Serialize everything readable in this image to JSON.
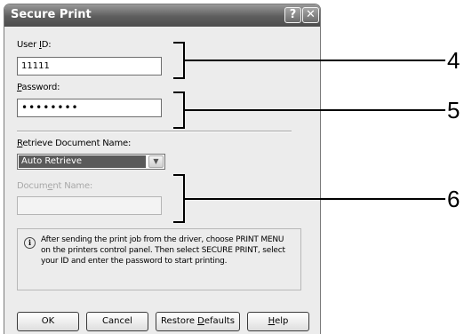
{
  "window": {
    "title": "Secure Print",
    "help_glyph": "?",
    "close_glyph": "✕"
  },
  "user_id": {
    "label_pre": "User ",
    "label_u": "I",
    "label_post": "D:",
    "value": "11111"
  },
  "password": {
    "label_u": "P",
    "label_post": "assword:",
    "value": "••••••••"
  },
  "retrieve": {
    "label_u": "R",
    "label_post": "etrieve Document Name:",
    "selected": "Auto Retrieve"
  },
  "document_name": {
    "label_pre": "Docum",
    "label_u": "e",
    "label_post": "nt Name:",
    "value": ""
  },
  "info": {
    "icon_glyph": "i",
    "text": "After sending the print job from the driver, choose PRINT MENU on the printers control panel.  Then select SECURE PRINT, select your ID and enter the password to start printing."
  },
  "buttons": {
    "ok": "OK",
    "cancel": "Cancel",
    "restore_pre": "Restore ",
    "restore_u": "D",
    "restore_post": "efaults",
    "help_u": "H",
    "help_post": "elp"
  },
  "callouts": [
    "4",
    "5",
    "6"
  ]
}
